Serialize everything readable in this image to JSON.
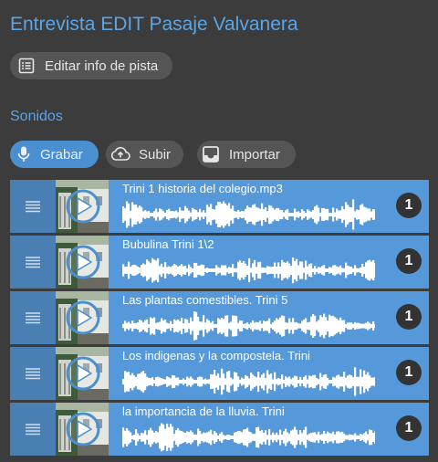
{
  "header": {
    "title": "Entrevista EDIT Pasaje Valvanera"
  },
  "toolbar": {
    "edit_label": "Editar info de pista"
  },
  "sounds": {
    "section_title": "Sonidos",
    "record_label": "Grabar",
    "upload_label": "Subir",
    "import_label": "Importar",
    "tracks": [
      {
        "name": "Trini 1 historia del colegio.mp3",
        "count": "1"
      },
      {
        "name": "Bubulina Trini 1\\2",
        "count": "1"
      },
      {
        "name": "Las plantas comestibles. Trini 5",
        "count": "1"
      },
      {
        "name": "Los indigenas y la compostela. Trini",
        "count": "1"
      },
      {
        "name": "la importancia de la lluvia. Trini",
        "count": "1"
      }
    ]
  },
  "colors": {
    "accent": "#5aa5e6",
    "row": "#5599db",
    "handle": "#4a7fb3",
    "background": "#3c3c3c"
  }
}
